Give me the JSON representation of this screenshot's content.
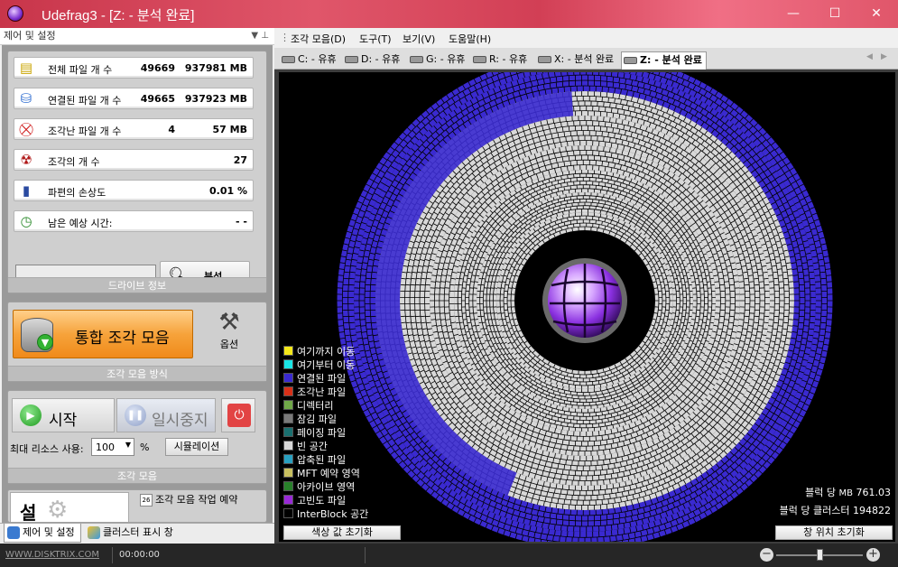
{
  "window": {
    "title": "Udefrag3 - [Z: - 분석 완료]",
    "minimize": "—",
    "maximize": "☐",
    "close": "✕"
  },
  "left_panel": {
    "header": "제어 및 설정",
    "header_pins": "▼ ⊥",
    "drive_info": {
      "rows": [
        {
          "label": "전체 파일 개 수",
          "count": "49669",
          "size": "937981 MB",
          "icon": "drive-icon"
        },
        {
          "label": "연결된 파일 개 수",
          "count": "49665",
          "size": "937923 MB",
          "icon": "linked-files-icon"
        },
        {
          "label": "조각난 파일 개 수",
          "count": "4",
          "size": "57 MB",
          "icon": "fragmented-files-icon"
        },
        {
          "label": "조각의 개 수",
          "count": "",
          "size": "27",
          "icon": "fragments-icon"
        },
        {
          "label": "파편의 손상도",
          "count": "",
          "size": "0.01 %",
          "icon": "damage-icon"
        },
        {
          "label": "남은 예상 시간:",
          "count": "",
          "size": "- -",
          "icon": "timer-icon"
        }
      ],
      "analyze_label": "분석",
      "caption": "드라이브 정보"
    },
    "defrag_method": {
      "consolidate_label": "통합 조각 모음",
      "options_label": "옵션",
      "caption": "조각 모음 방식"
    },
    "defrag": {
      "start_label": "시작",
      "pause_label": "일시중지",
      "resource_label": "최대 리소스 사용:",
      "resource_value": "100",
      "percent": "%",
      "simulation_label": "시뮬레이션",
      "caption": "조각 모음"
    },
    "schedule": {
      "settings_label": "설",
      "task_label": "조각 모음 작업 예약",
      "calendar_day": "26"
    },
    "tabs": [
      {
        "label": "제어 및 설정"
      },
      {
        "label": "클러스터 표시 창"
      }
    ]
  },
  "menu": {
    "items": [
      "조각 모음(D)",
      "도구(T)",
      "보기(V)",
      "도움말(H)"
    ]
  },
  "drive_tabs": [
    {
      "label": "C: - 유휴"
    },
    {
      "label": "D: - 유휴"
    },
    {
      "label": "G: - 유휴"
    },
    {
      "label": "R: - 유휴"
    },
    {
      "label": "X: - 분석 완료"
    },
    {
      "label": "Z: - 분석 완료"
    }
  ],
  "cluster_map": {
    "legend": [
      {
        "label": "여기까지 이동",
        "color": "#f5e81a"
      },
      {
        "label": "여기부터 이동",
        "color": "#19e6e6"
      },
      {
        "label": "연결된 파일",
        "color": "#3a2ad0"
      },
      {
        "label": "조각난 파일",
        "color": "#d83018"
      },
      {
        "label": "디렉터리",
        "color": "#70a848"
      },
      {
        "label": "잠김 파일",
        "color": "#7a7a7a"
      },
      {
        "label": "페이징 파일",
        "color": "#1a7070"
      },
      {
        "label": "빈 공간",
        "color": "#d8d8d8"
      },
      {
        "label": "압축된 파일",
        "color": "#28a0c0"
      },
      {
        "label": "MFT 예약 영역",
        "color": "#c8c060"
      },
      {
        "label": "아카이브 영역",
        "color": "#28802a"
      },
      {
        "label": "고빈도 파일",
        "color": "#9a2ad8"
      },
      {
        "label": "InterBlock 공간",
        "color": "#000000"
      }
    ],
    "mb_per_block_label": "블럭 당",
    "mb_per_block_unit": "MB",
    "mb_per_block_value": "761.03",
    "clusters_per_block_label": "블럭 당 클러스터",
    "clusters_per_block_value": "194822",
    "reset_color_label": "색상 값 초기화",
    "reset_window_label": "창 위치 초기화"
  },
  "statusbar": {
    "site": "WWW.DISKTRIX.COM",
    "time": "00:00:00",
    "zoom_level": 0.5
  }
}
